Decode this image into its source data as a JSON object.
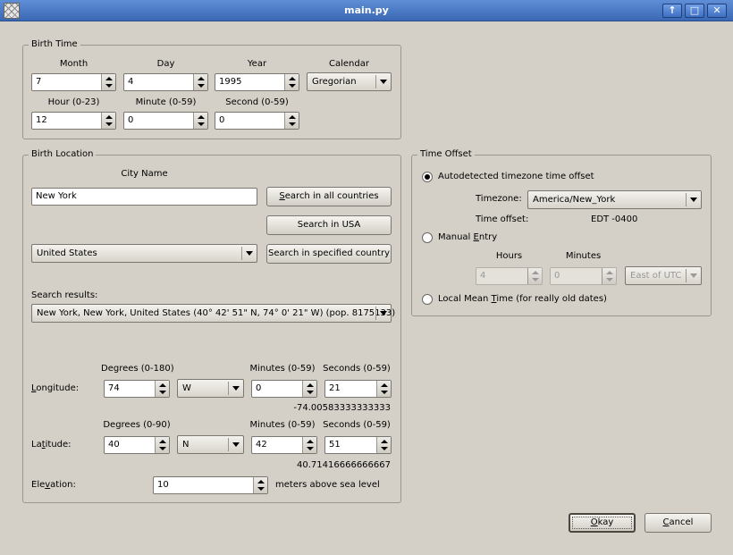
{
  "window": {
    "title": "main.py",
    "icons": {
      "app": "app-icon",
      "up": "arrow-up-icon",
      "maximize": "maximize-icon",
      "close": "close-icon"
    }
  },
  "birth_time": {
    "group_title": "Birth Time",
    "month_label": "Month",
    "month_value": "7",
    "day_label": "Day",
    "day_value": "4",
    "year_label": "Year",
    "year_value": "1995",
    "calendar_label": "Calendar",
    "calendar_value": "Gregorian",
    "hour_label": "Hour (0-23)",
    "hour_value": "12",
    "minute_label": "Minute (0-59)",
    "minute_value": "0",
    "second_label": "Second (0-59)",
    "second_value": "0"
  },
  "birth_location": {
    "group_title": "Birth Location",
    "city_name_label": "City Name",
    "city_value": "New York",
    "search_all_a": "S",
    "search_all_b": "earch in all countries",
    "search_usa": "Search in USA",
    "country_value": "United States",
    "search_country": "Search in specified country",
    "results_label": "Search results:",
    "result_value": "New York, New York, United States (40° 42' 51\" N, 74° 0' 21\" W) (pop. 8175133)",
    "lon_degrees_label": "Degrees (0-180)",
    "lon_minutes_label": "Minutes (0-59)",
    "lon_seconds_label": "Seconds (0-59)",
    "lon_label_a": "L",
    "lon_label_b": "ongitude:",
    "lon_degrees": "74",
    "lon_dir": "W",
    "lon_minutes": "0",
    "lon_seconds": "21",
    "lon_decimal": "-74.00583333333333",
    "lat_degrees_label": "Degrees (0-90)",
    "lat_minutes_label": "Minutes (0-59)",
    "lat_seconds_label": "Seconds (0-59)",
    "lat_label_a": "La",
    "lat_label_b": "t",
    "lat_label_c": "itude:",
    "lat_degrees": "40",
    "lat_dir": "N",
    "lat_minutes": "42",
    "lat_seconds": "51",
    "lat_decimal": "40.71416666666667",
    "elev_label_a": "Ele",
    "elev_label_b": "v",
    "elev_label_c": "ation:",
    "elev_value": "10",
    "elev_unit": "meters above sea level"
  },
  "time_offset": {
    "group_title": "Time Offset",
    "auto_label": "Autodetected timezone time offset",
    "timezone_label": "Timezone:",
    "timezone_value": "America/New_York",
    "offset_label": "Time offset:",
    "offset_value": "EDT -0400",
    "manual_a": "Manual ",
    "manual_b": "E",
    "manual_c": "ntry",
    "hours_label": "Hours",
    "hours_value": "4",
    "minutes_label": "Minutes",
    "minutes_value": "0",
    "direction_value": "East of UTC",
    "lmt_a": "Local Mean ",
    "lmt_b": "T",
    "lmt_c": "ime (for really old dates)"
  },
  "footer": {
    "okay_a": "O",
    "okay_b": "kay",
    "cancel_a": "C",
    "cancel_b": "ancel"
  }
}
